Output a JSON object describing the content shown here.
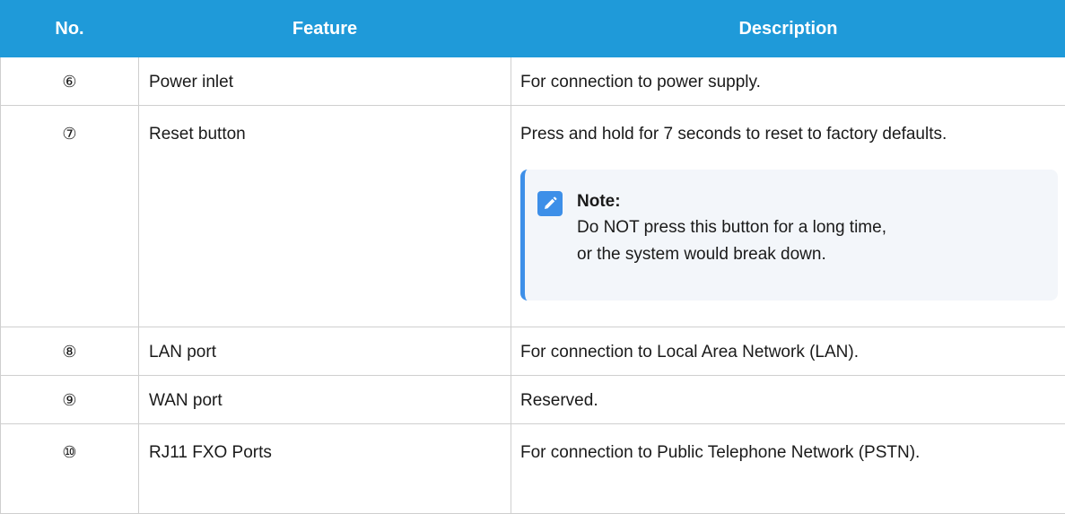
{
  "table": {
    "headers": [
      "No.",
      "Feature",
      "Description"
    ],
    "rows": [
      {
        "no": "⑥",
        "feature": "Power inlet",
        "description": "For connection to power supply."
      },
      {
        "no": "⑦",
        "feature": "Reset button",
        "description": "Press and hold for 7 seconds to reset to factory defaults.",
        "note": {
          "title": "Note:",
          "text_line1": "Do NOT press this button for a long time,",
          "text_line2": "or the system would break down."
        }
      },
      {
        "no": "⑧",
        "feature": "LAN port",
        "description": "For connection to Local Area Network (LAN)."
      },
      {
        "no": "⑨",
        "feature": "WAN port",
        "description": "Reserved."
      },
      {
        "no": "⑩",
        "feature": "RJ11 FXO Ports",
        "description": "For connection to Public Telephone Network (PSTN)."
      }
    ]
  },
  "colors": {
    "header_bg": "#1f9ad9",
    "note_accent": "#3d8fe8",
    "note_bg": "#f3f6fa"
  },
  "icons": {
    "note": "pencil-icon"
  }
}
